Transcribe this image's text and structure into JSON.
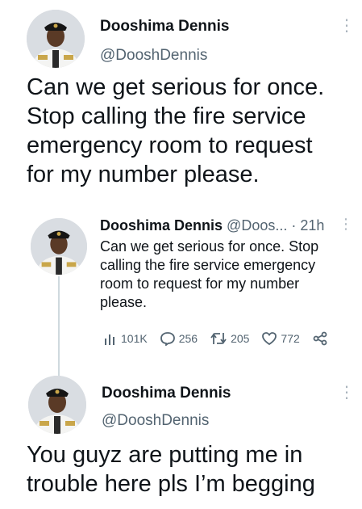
{
  "tweet1": {
    "author_name": "Dooshima Dennis",
    "author_handle": "@DooshDennis",
    "text_lines": [
      "Can we get serious for once.",
      "Stop calling the fire service",
      "emergency room to request",
      "for my number please."
    ]
  },
  "quoted": {
    "author_name": "Dooshima Dennis",
    "author_handle_trunc": "@Doos...",
    "separator": "·",
    "time": "21h",
    "text_lines": [
      "Can we get serious for once. Stop",
      "calling the fire service emergency",
      "room to request for my number",
      "please."
    ],
    "stats": {
      "views": "101K",
      "replies": "256",
      "retweets": "205",
      "likes": "772"
    },
    "icons": [
      "views-icon",
      "reply-icon",
      "retweet-icon",
      "like-icon",
      "share-icon"
    ]
  },
  "tweet3": {
    "author_name": "Dooshima Dennis",
    "author_handle": "@DooshDennis",
    "text_lines": [
      "You guyz are putting me in",
      "trouble here pls I’m begging"
    ]
  },
  "colors": {
    "text": "#0f1419",
    "secondary": "#536471",
    "thread_line": "#cfd9de"
  }
}
